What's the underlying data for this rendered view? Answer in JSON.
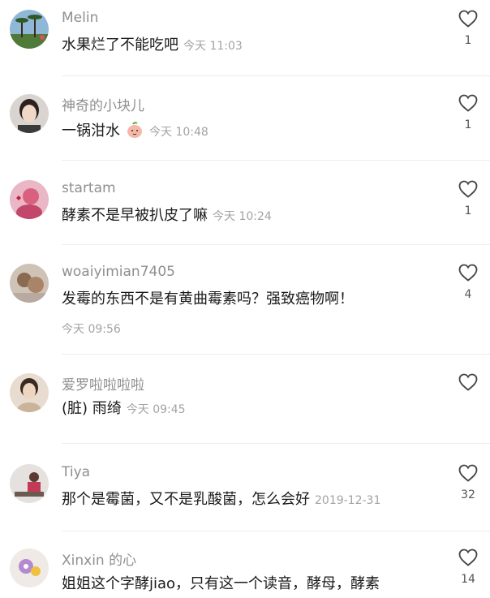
{
  "comments": [
    {
      "username": "Melin",
      "text": "水果烂了不能吃吧",
      "time": "今天 11:03",
      "likes": "1",
      "avatar_icon": "avatar-palm-trees"
    },
    {
      "username": "神奇的小块儿",
      "text": "一锅泔水",
      "emoji": "peach-face-emoji",
      "time": "今天 10:48",
      "likes": "1",
      "avatar_icon": "avatar-girl-portrait"
    },
    {
      "username": "startam",
      "text": "酵素不是早被扒皮了嘛",
      "time": "今天 10:24",
      "likes": "1",
      "avatar_icon": "avatar-pink-figure"
    },
    {
      "username": "woaiyimian7405",
      "text": "发霉的东西不是有黄曲霉素吗？强致癌物啊！",
      "time": "今天 09:56",
      "likes": "4",
      "avatar_icon": "avatar-bear-toy"
    },
    {
      "username": "爱罗啦啦啦啦",
      "text": "(脏) 雨绮",
      "time": "今天 09:45",
      "likes": "",
      "avatar_icon": "avatar-woman-portrait"
    },
    {
      "username": "Tiya",
      "text": "那个是霉菌，又不是乳酸菌，怎么会好",
      "time": "2019-12-31",
      "likes": "32",
      "avatar_icon": "avatar-sitting-figure"
    },
    {
      "username": "Xinxin 的心",
      "text": "姐姐这个字酵jiao，只有这一个读音，酵母，酵素",
      "time": "",
      "likes": "14",
      "avatar_icon": "avatar-cartoon"
    }
  ],
  "colors": {
    "username": "#8f8f8f",
    "text": "#1a1a1a",
    "time": "#a3a3a3",
    "divider": "#ededed"
  }
}
